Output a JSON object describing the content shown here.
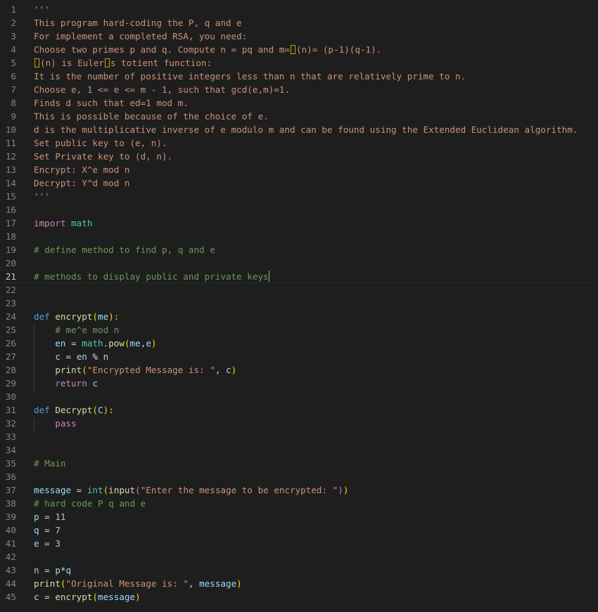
{
  "editor": {
    "language": "python",
    "current_line": 21,
    "line_numbers": [
      "1",
      "2",
      "3",
      "4",
      "5",
      "6",
      "7",
      "8",
      "9",
      "10",
      "11",
      "12",
      "13",
      "14",
      "15",
      "16",
      "17",
      "18",
      "19",
      "20",
      "21",
      "22",
      "23",
      "24",
      "25",
      "26",
      "27",
      "28",
      "29",
      "30",
      "31",
      "32",
      "33",
      "34",
      "35",
      "36",
      "37",
      "38",
      "39",
      "40",
      "41",
      "42",
      "43",
      "44",
      "45"
    ],
    "lines": [
      [
        {
          "t": "'''",
          "c": "str"
        }
      ],
      [
        {
          "t": "This program hard-coding the P, q and e",
          "c": "str"
        }
      ],
      [
        {
          "t": "For implement a completed RSA, you need:",
          "c": "str"
        }
      ],
      [
        {
          "t": "Choose two primes p and q. Compute n = pq and m=",
          "c": "str"
        },
        {
          "t": "",
          "c": "uc"
        },
        {
          "t": "(n)= (p-1)(q-1).",
          "c": "str"
        }
      ],
      [
        {
          "t": "",
          "c": "uc"
        },
        {
          "t": "(n) is Euler",
          "c": "str"
        },
        {
          "t": "",
          "c": "uc"
        },
        {
          "t": "s totient function:",
          "c": "str"
        }
      ],
      [
        {
          "t": "It is the number of positive integers less than n that are relatively prime to n.",
          "c": "str"
        }
      ],
      [
        {
          "t": "Choose e, 1 <= e <= m - 1, such that gcd(e,m)=1.",
          "c": "str"
        }
      ],
      [
        {
          "t": "Finds d such that ed=1 mod m.",
          "c": "str"
        }
      ],
      [
        {
          "t": "This is possible because of the choice of e.",
          "c": "str"
        }
      ],
      [
        {
          "t": "d is the multiplicative inverse of e modulo m and can be found using the Extended Euclidean algorithm.",
          "c": "str"
        }
      ],
      [
        {
          "t": "Set public key to (e, n).",
          "c": "str"
        }
      ],
      [
        {
          "t": "Set Private key to (d, n).",
          "c": "str"
        }
      ],
      [
        {
          "t": "Encrypt: X^e mod n",
          "c": "str"
        }
      ],
      [
        {
          "t": "Decrypt: Y^d mod n",
          "c": "str"
        }
      ],
      [
        {
          "t": "'''",
          "c": "str"
        }
      ],
      [],
      [
        {
          "t": "import",
          "c": "kw"
        },
        {
          "t": " ",
          "c": "op"
        },
        {
          "t": "math",
          "c": "ns"
        }
      ],
      [],
      [
        {
          "t": "# define method to find p, q and e",
          "c": "com"
        }
      ],
      [],
      [
        {
          "t": "# methods to display public and private keys",
          "c": "com"
        },
        {
          "t": "",
          "c": "cursor"
        }
      ],
      [],
      [],
      [
        {
          "t": "def",
          "c": "def"
        },
        {
          "t": " ",
          "c": "op"
        },
        {
          "t": "encrypt",
          "c": "fn"
        },
        {
          "t": "(",
          "c": "br1"
        },
        {
          "t": "me",
          "c": "par"
        },
        {
          "t": "):",
          "c": "br1"
        }
      ],
      [
        {
          "t": "    ",
          "c": "op"
        },
        {
          "t": "# me^e mod n",
          "c": "com"
        }
      ],
      [
        {
          "t": "    ",
          "c": "op"
        },
        {
          "t": "en",
          "c": "par"
        },
        {
          "t": " = ",
          "c": "op"
        },
        {
          "t": "math",
          "c": "ns"
        },
        {
          "t": ".",
          "c": "op"
        },
        {
          "t": "pow",
          "c": "fn"
        },
        {
          "t": "(",
          "c": "br1"
        },
        {
          "t": "me",
          "c": "par"
        },
        {
          "t": ",",
          "c": "op"
        },
        {
          "t": "e",
          "c": "par"
        },
        {
          "t": ")",
          "c": "br1"
        }
      ],
      [
        {
          "t": "    ",
          "c": "op"
        },
        {
          "t": "c",
          "c": "par"
        },
        {
          "t": " = ",
          "c": "op"
        },
        {
          "t": "en",
          "c": "par"
        },
        {
          "t": " % ",
          "c": "op"
        },
        {
          "t": "n",
          "c": "par"
        }
      ],
      [
        {
          "t": "    ",
          "c": "op"
        },
        {
          "t": "print",
          "c": "fn"
        },
        {
          "t": "(",
          "c": "br1"
        },
        {
          "t": "\"Encrypted Message is: \"",
          "c": "str"
        },
        {
          "t": ", ",
          "c": "op"
        },
        {
          "t": "c",
          "c": "par"
        },
        {
          "t": ")",
          "c": "br1"
        }
      ],
      [
        {
          "t": "    ",
          "c": "op"
        },
        {
          "t": "return",
          "c": "kw"
        },
        {
          "t": " ",
          "c": "op"
        },
        {
          "t": "c",
          "c": "par"
        }
      ],
      [],
      [
        {
          "t": "def",
          "c": "def"
        },
        {
          "t": " ",
          "c": "op"
        },
        {
          "t": "Decrypt",
          "c": "fn"
        },
        {
          "t": "(",
          "c": "br1"
        },
        {
          "t": "C",
          "c": "par"
        },
        {
          "t": "):",
          "c": "br1"
        }
      ],
      [
        {
          "t": "    ",
          "c": "op"
        },
        {
          "t": "pass",
          "c": "kw"
        }
      ],
      [],
      [],
      [
        {
          "t": "# Main",
          "c": "com"
        }
      ],
      [],
      [
        {
          "t": "message",
          "c": "par"
        },
        {
          "t": " = ",
          "c": "op"
        },
        {
          "t": "int",
          "c": "ns"
        },
        {
          "t": "(",
          "c": "br1"
        },
        {
          "t": "input",
          "c": "fn"
        },
        {
          "t": "(",
          "c": "br2"
        },
        {
          "t": "\"Enter the message to be encrypted: \"",
          "c": "str"
        },
        {
          "t": ")",
          "c": "br2"
        },
        {
          "t": ")",
          "c": "br1"
        }
      ],
      [
        {
          "t": "# hard code P q and e",
          "c": "com"
        }
      ],
      [
        {
          "t": "p",
          "c": "par"
        },
        {
          "t": " = ",
          "c": "op"
        },
        {
          "t": "11",
          "c": "num"
        }
      ],
      [
        {
          "t": "q",
          "c": "par"
        },
        {
          "t": " = ",
          "c": "op"
        },
        {
          "t": "7",
          "c": "num"
        }
      ],
      [
        {
          "t": "e",
          "c": "par"
        },
        {
          "t": " = ",
          "c": "op"
        },
        {
          "t": "3",
          "c": "num"
        }
      ],
      [],
      [
        {
          "t": "n",
          "c": "par"
        },
        {
          "t": " = ",
          "c": "op"
        },
        {
          "t": "p",
          "c": "par"
        },
        {
          "t": "*",
          "c": "op"
        },
        {
          "t": "q",
          "c": "par"
        }
      ],
      [
        {
          "t": "print",
          "c": "fn"
        },
        {
          "t": "(",
          "c": "br1"
        },
        {
          "t": "\"Original Message is: \"",
          "c": "str"
        },
        {
          "t": ", ",
          "c": "op"
        },
        {
          "t": "message",
          "c": "par"
        },
        {
          "t": ")",
          "c": "br1"
        }
      ],
      [
        {
          "t": "c",
          "c": "par"
        },
        {
          "t": " = ",
          "c": "op"
        },
        {
          "t": "encrypt",
          "c": "fn"
        },
        {
          "t": "(",
          "c": "br1"
        },
        {
          "t": "message",
          "c": "par"
        },
        {
          "t": ")",
          "c": "br1"
        }
      ]
    ]
  },
  "colors": {
    "background": "#1e1e1e",
    "string": "#ce9178",
    "comment": "#6a9955",
    "keyword": "#c586c0",
    "def_keyword": "#569cd6",
    "function": "#dcdcaa",
    "variable": "#9cdcfe",
    "module": "#4ec9b0",
    "number": "#b5cea8",
    "line_number": "#858585"
  }
}
